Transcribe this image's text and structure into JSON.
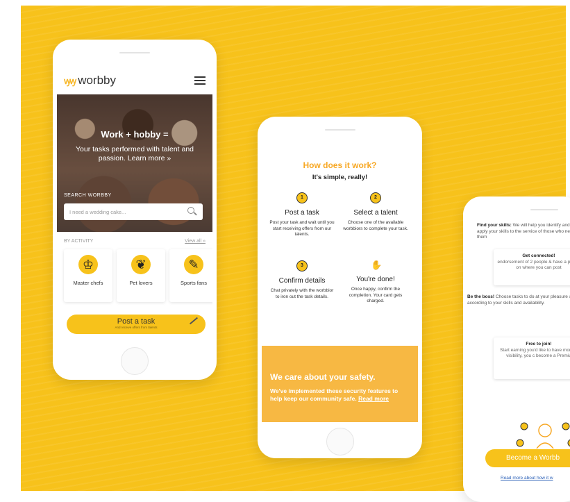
{
  "phone1": {
    "logo": "worbby",
    "logo_mark": "ꝡꝡ",
    "hero_title": "Work + hobby =",
    "hero_subtitle": "Your tasks performed with talent and passion. Learn more »",
    "search_label": "SEARCH WORBBY",
    "search_placeholder": "I need a wedding cake...",
    "activity_header": "BY ACTIVITY",
    "view_all": "View all »",
    "categories": [
      {
        "label": "Master chefs",
        "icon": "chef-hat-icon"
      },
      {
        "label": "Pet lovers",
        "icon": "dog-icon"
      },
      {
        "label": "Sports fans",
        "icon": "sports-icon"
      }
    ],
    "post_task": "Post a task",
    "post_task_sub": "And receive offers from talents"
  },
  "phone2": {
    "title": "How does it work?",
    "subtitle": "It's simple, really!",
    "steps": [
      {
        "num": "1",
        "title": "Post a task",
        "desc": "Post your task and wait until you start receiving offers from our talents."
      },
      {
        "num": "2",
        "title": "Select a talent",
        "desc": "Choose one of the available worbbiors to complete your task."
      },
      {
        "num": "3",
        "title": "Confirm details",
        "desc": "Chat privately with the worbbior to iron out the task details."
      },
      {
        "num": "",
        "title": "You're done!",
        "desc": "Once happy, confirm the completion. Your card gets charged."
      }
    ],
    "safety_title": "We care about your safety.",
    "safety_text": "We've implemented these security features to help keep our community safe.",
    "safety_link": "Read more"
  },
  "phone3": {
    "find_title": "Find your skills:",
    "find_text": "We will help you identify and apply your skills to the service of those who need them",
    "connected_title": "Get connected!",
    "connected_text": "endorsement of 2 people & have a profile on where you can post",
    "boss_title": "Be the boss!",
    "boss_text": "Choose tasks to do at your pleasure & according to your skills and availability.",
    "free_title": "Free to join!",
    "free_text": "Start earning you'd like to have more & visibility, you c become a Premiu",
    "button": "Become a Worbb",
    "link": "Read more about how it w"
  },
  "colors": {
    "accent": "#f7c21b",
    "orange": "#f7a825"
  }
}
